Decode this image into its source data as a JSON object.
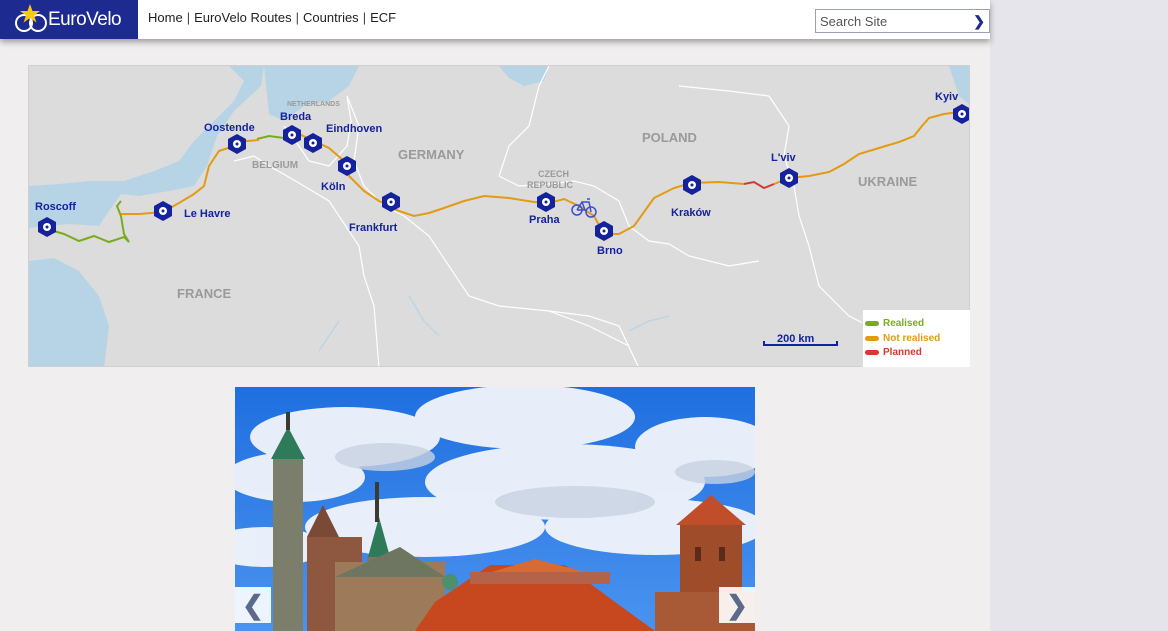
{
  "header": {
    "logo_text": "EuroVelo",
    "nav": [
      "Home",
      "EuroVelo Routes",
      "Countries",
      "ECF"
    ],
    "nav_separator": "|",
    "search": {
      "placeholder": "Search Site",
      "button_glyph": "❯"
    }
  },
  "map": {
    "countries": [
      "FRANCE",
      "BELGIUM",
      "NETHERLANDS",
      "GERMANY",
      "CZECH",
      "REPUBLIC",
      "POLAND",
      "UKRAINE"
    ],
    "cities": [
      "Roscoff",
      "Le Havre",
      "Oostende",
      "Breda",
      "Eindhoven",
      "Köln",
      "Frankfurt",
      "Praha",
      "Brno",
      "Kraków",
      "L'viv",
      "Kyiv"
    ],
    "scale_label": "200 km",
    "legend": [
      {
        "label": "Realised",
        "color": "#7aab1f"
      },
      {
        "label": "Not realised",
        "color": "#e29b12"
      },
      {
        "label": "Planned",
        "color": "#d43a2f"
      }
    ],
    "colors": {
      "sea": "#b7d4e6",
      "land": "#dcdcdc",
      "border": "#ffffff",
      "marker": "#14229c"
    }
  },
  "slideshow": {
    "prev_glyph": "❮",
    "next_glyph": "❯"
  }
}
